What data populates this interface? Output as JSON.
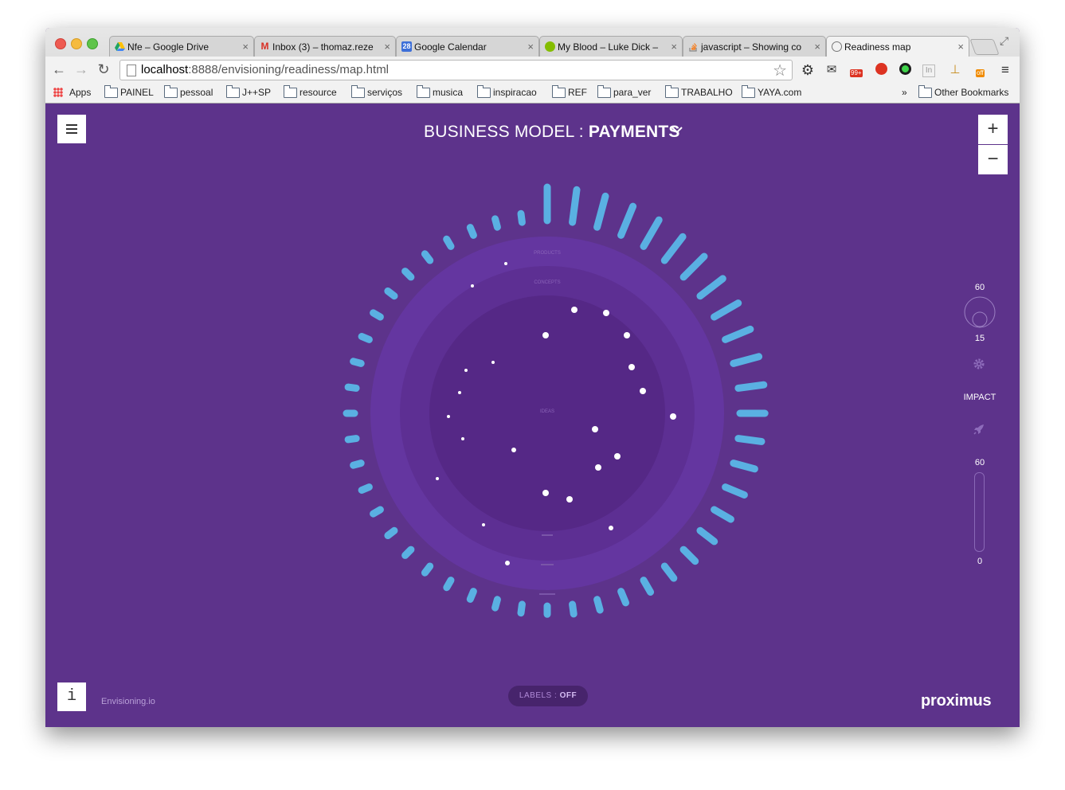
{
  "browser": {
    "tabs": [
      {
        "title": "Nfe – Google Drive",
        "icon": "google-drive-icon",
        "color": "#1fa463"
      },
      {
        "title": "Inbox (3) – thomaz.reze",
        "icon": "gmail-icon",
        "color": "#d93025"
      },
      {
        "title": "Google Calendar",
        "icon": "calendar-icon",
        "color": "#3d6fd8",
        "badge": "28"
      },
      {
        "title": "My Blood – Luke Dick –",
        "icon": "spotify-icon",
        "color": "#84bd00"
      },
      {
        "title": "javascript – Showing co",
        "icon": "stackoverflow-icon",
        "color": "#f48024"
      },
      {
        "title": "Readiness map",
        "icon": "globe-icon",
        "color": "#777777"
      }
    ],
    "url_host": "localhost",
    "url_rest": ":8888/envisioning/readiness/map.html",
    "extension_badge": "99+",
    "extension_badge2": "off",
    "bookmarks": [
      "Apps",
      "PAINEL",
      "pessoal",
      "J++SP",
      "resource",
      "serviços",
      "musica",
      "inspiracao",
      "REF",
      "para_ver",
      "TRABALHO",
      "YAYA.com"
    ],
    "more_bookmarks": "»",
    "other_bookmarks": "Other Bookmarks"
  },
  "app": {
    "title_prefix": "BUSINESS MODEL : ",
    "title_value": "PAYMENTS",
    "zoom_in": "+",
    "zoom_out": "−",
    "ring_labels": [
      "PRODUCTS",
      "CONCEPTS",
      "IDEAS"
    ],
    "ring_colors": [
      "#6436a0",
      "#5d2f93",
      "#552886"
    ],
    "tick_color": "#5ab0e2",
    "dot_color": "#ffffff",
    "radius_slider": {
      "max": "60",
      "min": "15",
      "value": 15
    },
    "settings_icon": "gear-icon",
    "impact_label": "IMPACT",
    "impact_icon": "rocket-icon",
    "impact_slider": {
      "max": "60",
      "min": "0"
    },
    "info_label": "i",
    "brand_link": "Envisioning.io",
    "labels_prefix": "LABELS : ",
    "labels_state": "OFF",
    "logo": "proximus"
  }
}
